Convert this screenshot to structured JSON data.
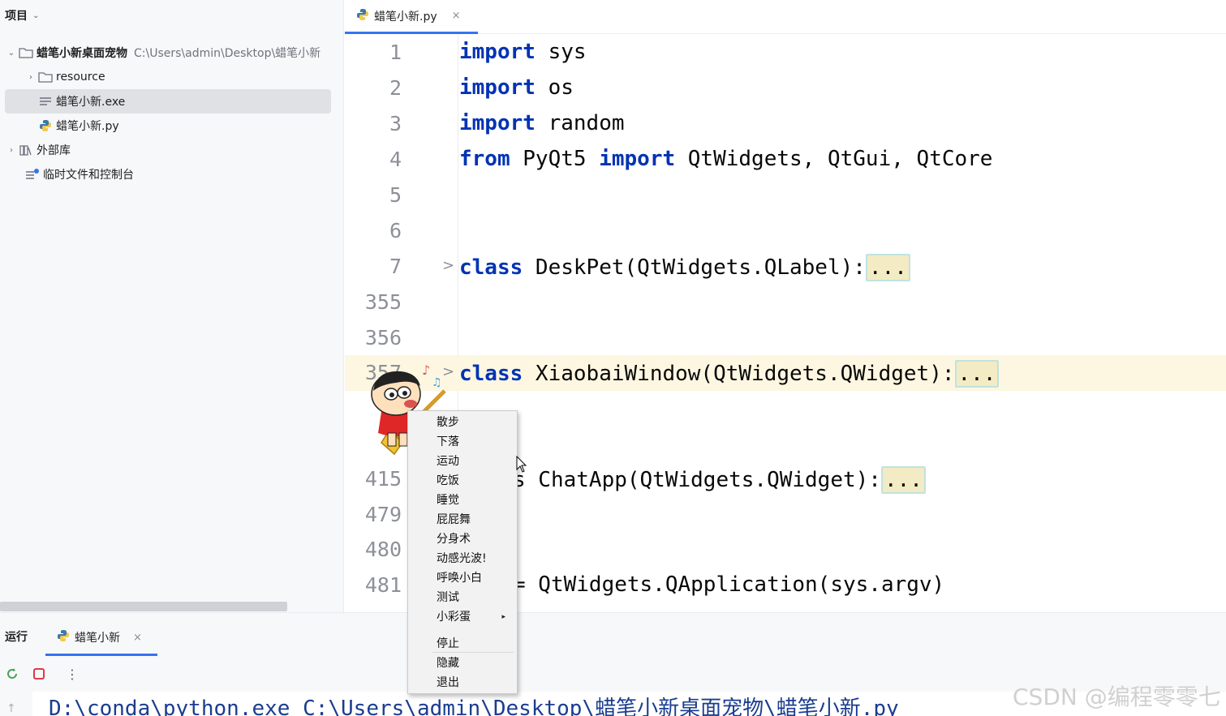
{
  "project": {
    "header": "项目",
    "root_name": "蜡笔小新桌面宠物",
    "root_path": "C:\\Users\\admin\\Desktop\\蜡笔小新",
    "items": [
      {
        "label": "resource",
        "icon": "folder-icon"
      },
      {
        "label": "蜡笔小新.exe",
        "icon": "text-file-icon"
      },
      {
        "label": "蜡笔小新.py",
        "icon": "python-file-icon"
      }
    ],
    "external_libraries": "外部库",
    "scratches": "临时文件和控制台"
  },
  "editor": {
    "tab_label": "蜡笔小新.py",
    "tab_close": "×",
    "fold_marker": ">",
    "collapsed_text": "...",
    "lines": [
      {
        "num": "1",
        "kw": "import",
        "rest": " sys"
      },
      {
        "num": "2",
        "kw": "import",
        "rest": " os"
      },
      {
        "num": "3",
        "kw": "import",
        "rest": " random"
      },
      {
        "num": "4",
        "kw": "from",
        "mid": " PyQt5 ",
        "kw2": "import",
        "rest": " QtWidgets, QtGui, QtCore"
      },
      {
        "num": "5"
      },
      {
        "num": "6"
      },
      {
        "num": "7",
        "kw": "class",
        "rest": " DeskPet(QtWidgets.QLabel):"
      },
      {
        "num": "355"
      },
      {
        "num": "356"
      },
      {
        "num": "357",
        "kw": "class",
        "rest": " XiaobaiWindow(QtWidgets.QWidget):"
      },
      {
        "num": "415",
        "rest": "s ChatApp(QtWidgets.QWidget):"
      },
      {
        "num": "479"
      },
      {
        "num": "480"
      },
      {
        "num": "481",
        "rest": "= QtWidgets.QApplication(sys.argv)"
      }
    ]
  },
  "context_menu": {
    "items": [
      "散步",
      "下落",
      "运动",
      "吃饭",
      "睡觉",
      "屁屁舞",
      "分身术",
      "动感光波!",
      "呼唤小白",
      "测试",
      "小彩蛋"
    ],
    "submenu_arrow": "▸",
    "items_after_separator": [
      "停止",
      "隐藏",
      "退出"
    ]
  },
  "run": {
    "label": "运行",
    "tab_label": "蜡笔小新",
    "tab_close": "×",
    "more_menu": "⋮",
    "console_text": "D:\\conda\\python.exe C:\\Users\\admin\\Desktop\\蜡笔小新桌面宠物\\蜡笔小新.py"
  },
  "watermark": "CSDN @编程零零七",
  "colors": {
    "keyword": "#0033b3",
    "accent": "#3574f0",
    "current_line": "#fdf7e2",
    "console_text": "#1a3d8f"
  }
}
